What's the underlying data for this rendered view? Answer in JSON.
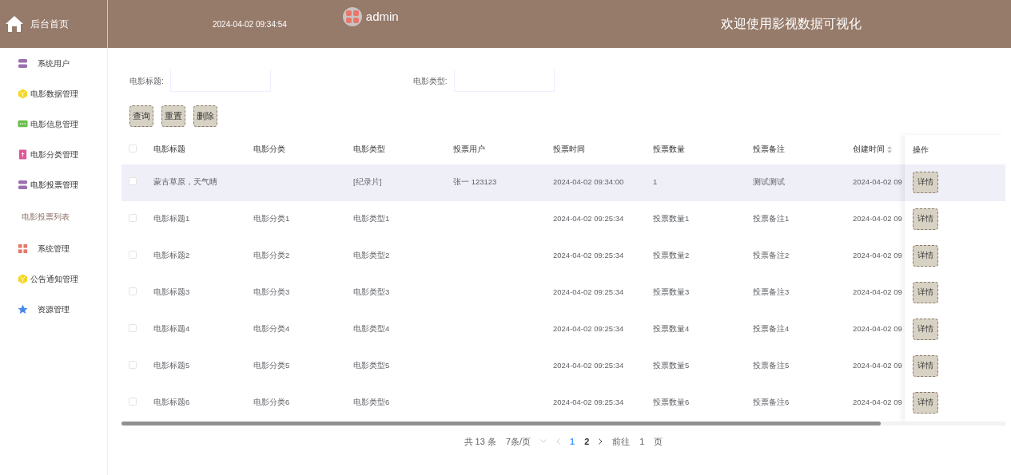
{
  "header": {
    "home_label": "后台首页",
    "datetime": "2024-04-02 09:34:54",
    "user": "admin",
    "welcome": "欢迎使用影视数据可视化"
  },
  "sidebar": {
    "items": [
      {
        "label": "系统用户",
        "expanded": false
      },
      {
        "label": "电影数据管理",
        "expanded": false
      },
      {
        "label": "电影信息管理",
        "expanded": false
      },
      {
        "label": "电影分类管理",
        "expanded": false
      },
      {
        "label": "电影投票管理",
        "expanded": true,
        "children": [
          {
            "label": "电影投票列表"
          }
        ]
      },
      {
        "label": "系统管理",
        "expanded": false
      },
      {
        "label": "公告通知管理",
        "expanded": false
      },
      {
        "label": "资源管理",
        "expanded": false
      }
    ]
  },
  "filters": [
    {
      "label": "电影标题:"
    },
    {
      "label": "电影类型:"
    }
  ],
  "actions": [
    "查询",
    "重置",
    "删除"
  ],
  "table": {
    "columns": [
      "电影标题",
      "电影分类",
      "电影类型",
      "投票用户",
      "投票时间",
      "投票数量",
      "投票备注",
      "创建时间"
    ],
    "action_column": "操作",
    "header_checked": false,
    "rows": [
      {
        "checked": false,
        "highlighted": true,
        "cells": [
          "蒙古草原，天气晴",
          "",
          "[纪录片]",
          "张一 123123",
          "2024-04-02 09:34:00",
          "1",
          "测试测试",
          "2024-04-02 09"
        ],
        "action": "详情"
      },
      {
        "checked": false,
        "highlighted": false,
        "cells": [
          "电影标题1",
          "电影分类1",
          "电影类型1",
          "",
          "2024-04-02 09:25:34",
          "投票数量1",
          "投票备注1",
          "2024-04-02 09"
        ],
        "action": "详情"
      },
      {
        "checked": false,
        "highlighted": false,
        "cells": [
          "电影标题2",
          "电影分类2",
          "电影类型2",
          "",
          "2024-04-02 09:25:34",
          "投票数量2",
          "投票备注2",
          "2024-04-02 09"
        ],
        "action": "详情"
      },
      {
        "checked": false,
        "highlighted": false,
        "cells": [
          "电影标题3",
          "电影分类3",
          "电影类型3",
          "",
          "2024-04-02 09:25:34",
          "投票数量3",
          "投票备注3",
          "2024-04-02 09"
        ],
        "action": "详情"
      },
      {
        "checked": false,
        "highlighted": false,
        "cells": [
          "电影标题4",
          "电影分类4",
          "电影类型4",
          "",
          "2024-04-02 09:25:34",
          "投票数量4",
          "投票备注4",
          "2024-04-02 09"
        ],
        "action": "详情"
      },
      {
        "checked": false,
        "highlighted": false,
        "cells": [
          "电影标题5",
          "电影分类5",
          "电影类型5",
          "",
          "2024-04-02 09:25:34",
          "投票数量5",
          "投票备注5",
          "2024-04-02 09"
        ],
        "action": "详情"
      },
      {
        "checked": false,
        "highlighted": false,
        "cells": [
          "电影标题6",
          "电影分类6",
          "电影类型6",
          "",
          "2024-04-02 09:25:34",
          "投票数量6",
          "投票备注6",
          "2024-04-02 09"
        ],
        "action": "详情"
      }
    ]
  },
  "pagination": {
    "total": "共 13 条",
    "page_size": "7条/页",
    "pages": [
      {
        "label": "1",
        "selected": true
      },
      {
        "label": "2",
        "selected": false
      }
    ],
    "goto_label": "前往",
    "goto_value": "1",
    "goto_suffix": "页"
  }
}
